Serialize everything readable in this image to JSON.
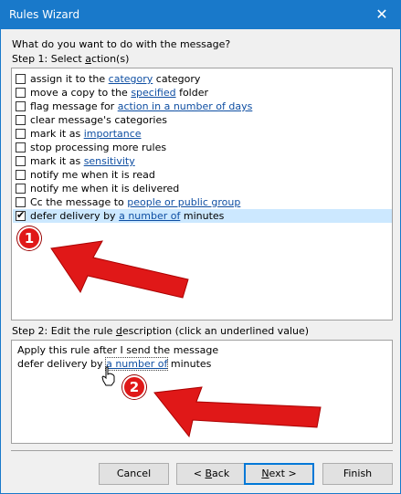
{
  "window": {
    "title": "Rules Wizard",
    "close_glyph": "✕"
  },
  "question": "What do you want to do with the message?",
  "step1": {
    "label_pre": "Step 1: Select ",
    "label_ul": "a",
    "label_post": "ction(s)"
  },
  "actions": [
    {
      "checked": false,
      "pre": "assign it to the ",
      "link": "category",
      "post": " category"
    },
    {
      "checked": false,
      "pre": "move a copy to the ",
      "link": "specified",
      "post": " folder"
    },
    {
      "checked": false,
      "pre": "flag message for ",
      "link": "action in a number of days",
      "post": ""
    },
    {
      "checked": false,
      "pre": "clear message's categories",
      "link": "",
      "post": ""
    },
    {
      "checked": false,
      "pre": "mark it as ",
      "link": "importance",
      "post": ""
    },
    {
      "checked": false,
      "pre": "stop processing more rules",
      "link": "",
      "post": ""
    },
    {
      "checked": false,
      "pre": "mark it as ",
      "link": "sensitivity",
      "post": ""
    },
    {
      "checked": false,
      "pre": "notify me when it is read",
      "link": "",
      "post": ""
    },
    {
      "checked": false,
      "pre": "notify me when it is delivered",
      "link": "",
      "post": ""
    },
    {
      "checked": false,
      "pre": "Cc the message to ",
      "link": "people or public group",
      "post": ""
    },
    {
      "checked": true,
      "pre": "defer delivery by ",
      "link": "a number of",
      "post": " minutes"
    }
  ],
  "step2": {
    "label_pre": "Step 2: Edit the rule ",
    "label_ul": "d",
    "label_post": "escription (click an underlined value)"
  },
  "description": {
    "line1": "Apply this rule after I send the message",
    "line2_pre": "defer delivery by ",
    "line2_link": "a number of",
    "line2_post": " minutes"
  },
  "buttons": {
    "cancel": "Cancel",
    "back_pre": "< ",
    "back_ul": "B",
    "back_post": "ack",
    "next_ul": "N",
    "next_post": "ext >",
    "finish": "Finish"
  },
  "annotations": {
    "badge1": "1",
    "badge2": "2",
    "color": "#e01818"
  },
  "colors": {
    "titlebar": "#1979ca",
    "link": "#0e4ea2",
    "selection": "#cce8ff"
  }
}
